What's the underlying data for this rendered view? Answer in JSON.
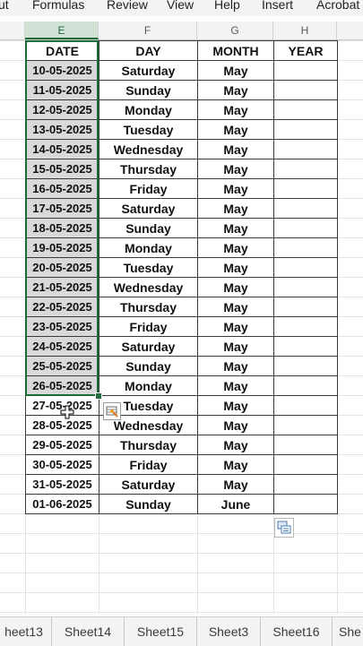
{
  "menu": [
    "ut",
    "Formulas",
    "Review",
    "View",
    "Help",
    "Insert",
    "Acrobat"
  ],
  "columns": [
    "E",
    "F",
    "G",
    "H"
  ],
  "headers": [
    "DATE",
    "DAY",
    "MONTH",
    "YEAR"
  ],
  "rows": [
    [
      "10-05-2025",
      "Saturday",
      "May",
      ""
    ],
    [
      "11-05-2025",
      "Sunday",
      "May",
      ""
    ],
    [
      "12-05-2025",
      "Monday",
      "May",
      ""
    ],
    [
      "13-05-2025",
      "Tuesday",
      "May",
      ""
    ],
    [
      "14-05-2025",
      "Wednesday",
      "May",
      ""
    ],
    [
      "15-05-2025",
      "Thursday",
      "May",
      ""
    ],
    [
      "16-05-2025",
      "Friday",
      "May",
      ""
    ],
    [
      "17-05-2025",
      "Saturday",
      "May",
      ""
    ],
    [
      "18-05-2025",
      "Sunday",
      "May",
      ""
    ],
    [
      "19-05-2025",
      "Monday",
      "May",
      ""
    ],
    [
      "20-05-2025",
      "Tuesday",
      "May",
      ""
    ],
    [
      "21-05-2025",
      "Wednesday",
      "May",
      ""
    ],
    [
      "22-05-2025",
      "Thursday",
      "May",
      ""
    ],
    [
      "23-05-2025",
      "Friday",
      "May",
      ""
    ],
    [
      "24-05-2025",
      "Saturday",
      "May",
      ""
    ],
    [
      "25-05-2025",
      "Sunday",
      "May",
      ""
    ],
    [
      "26-05-2025",
      "Monday",
      "May",
      ""
    ],
    [
      "27-05-2025",
      "Tuesday",
      "May",
      ""
    ],
    [
      "28-05-2025",
      "Wednesday",
      "May",
      ""
    ],
    [
      "29-05-2025",
      "Thursday",
      "May",
      ""
    ],
    [
      "30-05-2025",
      "Friday",
      "May",
      ""
    ],
    [
      "31-05-2025",
      "Saturday",
      "May",
      ""
    ],
    [
      "01-06-2025",
      "Sunday",
      "June",
      ""
    ]
  ],
  "sheet_tabs": [
    "heet13",
    "Sheet14",
    "Sheet15",
    "Sheet3",
    "Sheet16",
    "She"
  ],
  "icons": {
    "quick_analysis": "quick-analysis-icon",
    "paste_options": "paste-options-icon",
    "cursor": "cell-select-cursor-icon"
  },
  "colors": {
    "selection": "#1e6b3a",
    "selected_fill": "#d9d9d9"
  }
}
